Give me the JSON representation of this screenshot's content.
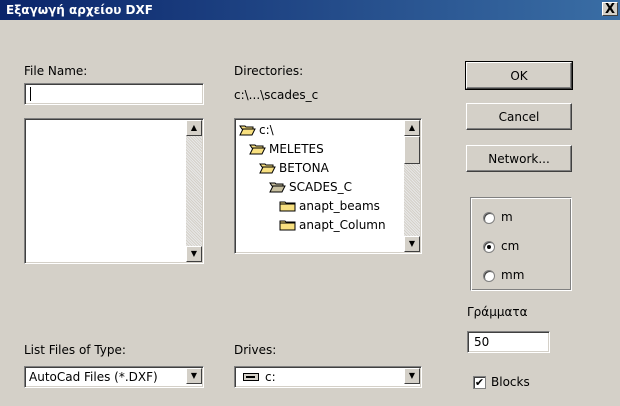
{
  "window": {
    "title": "Εξαγωγή αρχείου DXF",
    "close_glyph": "X"
  },
  "file_name": {
    "label": "File Name:",
    "value": "",
    "files": []
  },
  "directories": {
    "label": "Directories:",
    "path": "c:\\...\\scades_c",
    "items": [
      {
        "label": "c:\\",
        "icon": "open-folder-icon"
      },
      {
        "label": "MELETES",
        "icon": "open-folder-icon"
      },
      {
        "label": "BETONA",
        "icon": "open-folder-icon"
      },
      {
        "label": "SCADES_C",
        "icon": "open-folder-icon"
      },
      {
        "label": "anapt_beams",
        "icon": "folder-icon"
      },
      {
        "label": "anapt_Column",
        "icon": "folder-icon"
      }
    ]
  },
  "buttons": {
    "ok": "OK",
    "cancel": "Cancel",
    "network": "Network..."
  },
  "units": {
    "options": [
      {
        "label": "m",
        "selected": false
      },
      {
        "label": "cm",
        "selected": true
      },
      {
        "label": "mm",
        "selected": false
      }
    ]
  },
  "letters": {
    "label": "Γράμματα",
    "value": "50"
  },
  "file_type": {
    "label": "List Files of Type:",
    "value": "AutoCad Files (*.DXF)"
  },
  "drives": {
    "label": "Drives:",
    "value": "c:"
  },
  "blocks": {
    "label": "Blocks",
    "checked": true
  },
  "colors": {
    "title_bar_start": "#0a246a",
    "title_bar_end": "#3a6ea5",
    "dialog_bg": "#d4d0c8",
    "folder_yellow": "#f8e080"
  }
}
